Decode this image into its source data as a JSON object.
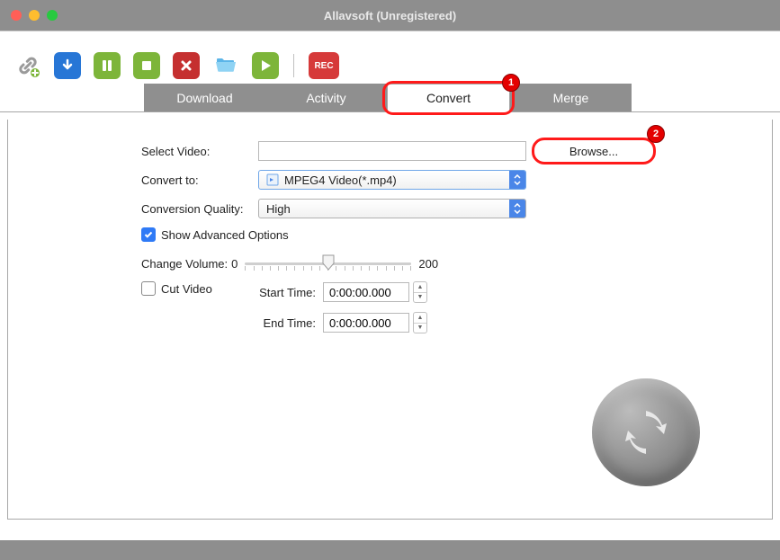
{
  "window": {
    "title": "Allavsoft (Unregistered)"
  },
  "tabs": {
    "download": "Download",
    "activity": "Activity",
    "convert": "Convert",
    "merge": "Merge"
  },
  "form": {
    "select_video_label": "Select Video:",
    "browse_label": "Browse...",
    "convert_to_label": "Convert to:",
    "convert_to_value": "MPEG4 Video(*.mp4)",
    "quality_label": "Conversion Quality:",
    "quality_value": "High",
    "show_advanced_label": "Show Advanced Options",
    "change_volume_label": "Change Volume:",
    "volume_min": "0",
    "volume_max": "200",
    "cut_video_label": "Cut Video",
    "start_time_label": "Start Time:",
    "start_time_value": "0:00:00.000",
    "end_time_label": "End Time:",
    "end_time_value": "0:00:00.000"
  },
  "annotations": {
    "one": "1",
    "two": "2"
  },
  "toolbar": {
    "link": "link-add-icon",
    "download": "download-icon",
    "pause": "pause-icon",
    "stop": "stop-icon",
    "delete": "delete-icon",
    "open": "folder-open-icon",
    "play": "play-icon",
    "rec": "REC"
  }
}
